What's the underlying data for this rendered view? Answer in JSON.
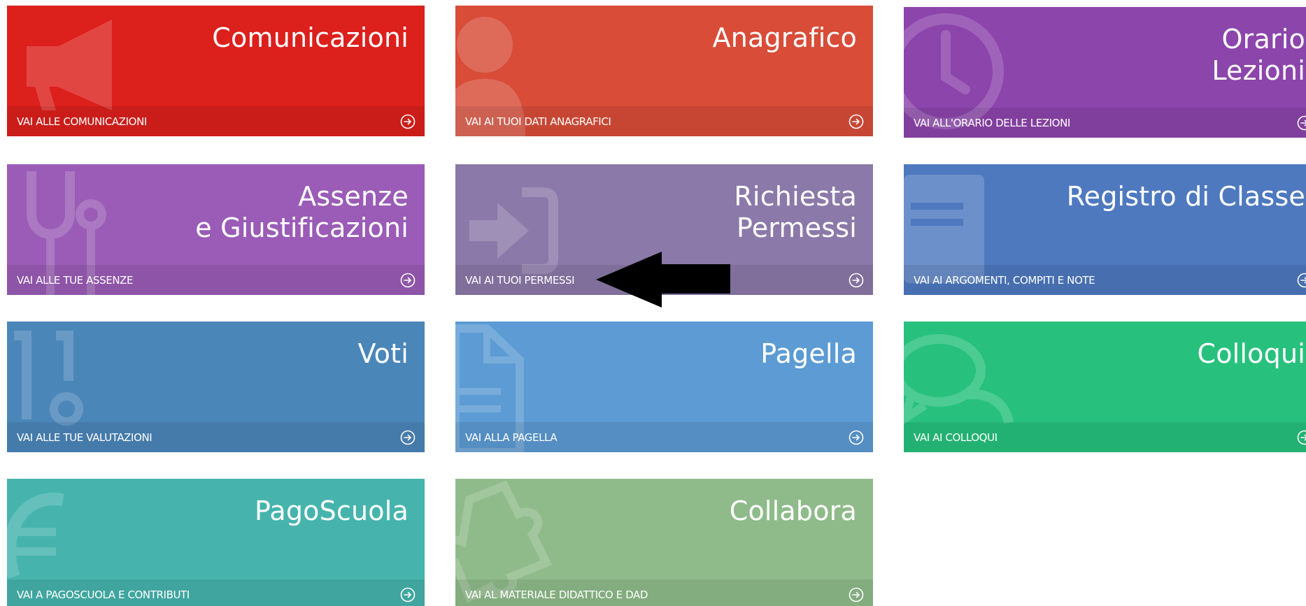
{
  "tiles": [
    {
      "id": "comunicazioni",
      "title": "Comunicazioni",
      "link": "VAI ALLE COMUNICAZIONI",
      "color": "#dc201c",
      "icon": "megaphone-icon"
    },
    {
      "id": "anagrafico",
      "title": "Anagrafico",
      "link": "VAI AI TUOI DATI ANAGRAFICI",
      "color": "#d84c38",
      "icon": "user-icon"
    },
    {
      "id": "orario",
      "title": "Orario\nLezioni",
      "link": "VAI ALL'ORARIO DELLE LEZIONI",
      "color": "#8c45ab",
      "icon": "clock-icon"
    },
    {
      "id": "assenze",
      "title": "Assenze\ne Giustificazioni",
      "link": "VAI ALLE TUE ASSENZE",
      "color": "#9a5cb6",
      "icon": "stethoscope-icon"
    },
    {
      "id": "permessi",
      "title": "Richiesta\nPermessi",
      "link": "VAI AI TUOI PERMESSI",
      "color": "#8b79a9",
      "icon": "sign-in-icon"
    },
    {
      "id": "registro",
      "title": "Registro di Classe",
      "link": "VAI AI ARGOMENTI, COMPITI E NOTE",
      "color": "#4e79bf",
      "icon": "book-icon"
    },
    {
      "id": "voti",
      "title": "Voti",
      "link": "VAI ALLE TUE VALUTAZIONI",
      "color": "#4b86b9",
      "icon": "numbers-icon"
    },
    {
      "id": "pagella",
      "title": "Pagella",
      "link": "VAI ALLA PAGELLA",
      "color": "#5c9bd3",
      "icon": "document-icon"
    },
    {
      "id": "colloqui",
      "title": "Colloqui",
      "link": "VAI AI COLLOQUI",
      "color": "#27c17d",
      "icon": "chat-bubbles-icon"
    },
    {
      "id": "pagoscuola",
      "title": "PagoScuola",
      "link": "VAI A PAGOSCUOLA E CONTRIBUTI",
      "color": "#46b4ad",
      "icon": "euro-icon"
    },
    {
      "id": "collabora",
      "title": "Collabora",
      "link": "VAI AL MATERIALE DIDATTICO E DAD",
      "color": "#8fbb8a",
      "icon": "puzzle-icon"
    }
  ],
  "annotation": {
    "icon": "pointer-arrow-icon",
    "color": "#000000"
  }
}
